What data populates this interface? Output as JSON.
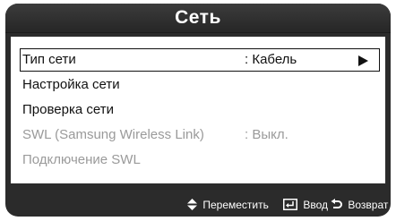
{
  "screen": {
    "title": "Сеть"
  },
  "menu": {
    "items": [
      {
        "label": "Тип сети",
        "value": ": Кабель",
        "selected": true,
        "enabled": true,
        "has_submenu_arrow": true
      },
      {
        "label": "Настройка сети",
        "value": "",
        "selected": false,
        "enabled": true
      },
      {
        "label": "Проверка сети",
        "value": "",
        "selected": false,
        "enabled": true
      },
      {
        "label": "SWL (Samsung Wireless Link)",
        "value": ": Выкл.",
        "selected": false,
        "enabled": false
      },
      {
        "label": "Подключение SWL",
        "value": "",
        "selected": false,
        "enabled": false
      }
    ]
  },
  "help_bar": {
    "move_label": "Переместить",
    "move_icon": "up-down-arrows-icon",
    "enter_label": "Ввод",
    "enter_icon": "enter-icon",
    "return_label": "Возврат",
    "return_icon": "return-arrow-icon"
  },
  "colors": {
    "osd_background": "#2b2b2b",
    "panel_background": "#ffffff",
    "text": "#111111",
    "disabled_text": "#9a9a9a",
    "help_text": "#ffffff"
  }
}
